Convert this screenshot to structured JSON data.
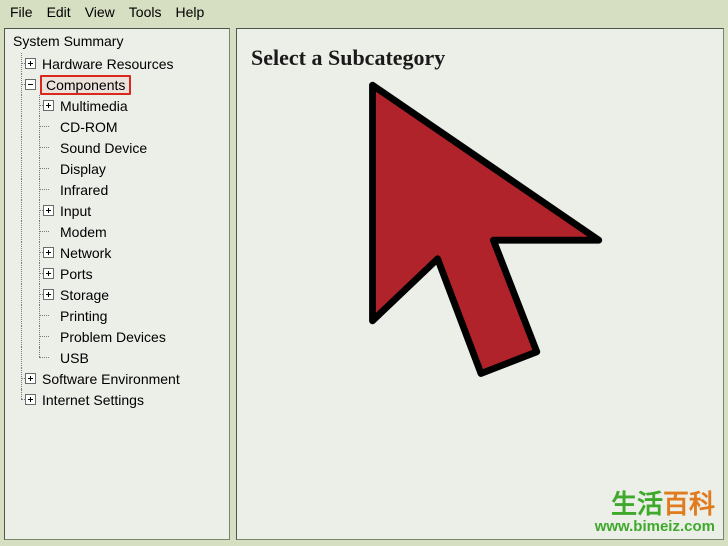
{
  "menubar": {
    "items": [
      {
        "label": "File"
      },
      {
        "label": "Edit"
      },
      {
        "label": "View"
      },
      {
        "label": "Tools"
      },
      {
        "label": "Help"
      }
    ]
  },
  "tree": {
    "root": "System Summary",
    "nodes": [
      {
        "label": "Hardware Resources",
        "box": "plus",
        "depth": 1,
        "last": false,
        "highlight": false
      },
      {
        "label": "Components",
        "box": "minus",
        "depth": 1,
        "last": false,
        "highlight": true
      },
      {
        "label": "Multimedia",
        "box": "plus",
        "depth": 2,
        "last": false,
        "highlight": false
      },
      {
        "label": "CD-ROM",
        "box": "none",
        "depth": 2,
        "last": false,
        "highlight": false
      },
      {
        "label": "Sound Device",
        "box": "none",
        "depth": 2,
        "last": false,
        "highlight": false
      },
      {
        "label": "Display",
        "box": "none",
        "depth": 2,
        "last": false,
        "highlight": false
      },
      {
        "label": "Infrared",
        "box": "none",
        "depth": 2,
        "last": false,
        "highlight": false
      },
      {
        "label": "Input",
        "box": "plus",
        "depth": 2,
        "last": false,
        "highlight": false
      },
      {
        "label": "Modem",
        "box": "none",
        "depth": 2,
        "last": false,
        "highlight": false
      },
      {
        "label": "Network",
        "box": "plus",
        "depth": 2,
        "last": false,
        "highlight": false
      },
      {
        "label": "Ports",
        "box": "plus",
        "depth": 2,
        "last": false,
        "highlight": false
      },
      {
        "label": "Storage",
        "box": "plus",
        "depth": 2,
        "last": false,
        "highlight": false
      },
      {
        "label": "Printing",
        "box": "none",
        "depth": 2,
        "last": false,
        "highlight": false
      },
      {
        "label": "Problem Devices",
        "box": "none",
        "depth": 2,
        "last": false,
        "highlight": false
      },
      {
        "label": "USB",
        "box": "none",
        "depth": 2,
        "last": true,
        "highlight": false
      },
      {
        "label": "Software Environment",
        "box": "plus",
        "depth": 1,
        "last": false,
        "highlight": false
      },
      {
        "label": "Internet Settings",
        "box": "plus",
        "depth": 1,
        "last": true,
        "highlight": false
      }
    ]
  },
  "content": {
    "headline": "Select a Subcategory"
  },
  "watermark": {
    "logo_a": "生活",
    "logo_b": "百科",
    "url": "www.bimeiz.com"
  },
  "colors": {
    "highlight_border": "#d8291c",
    "cursor_fill": "#b0232a"
  }
}
